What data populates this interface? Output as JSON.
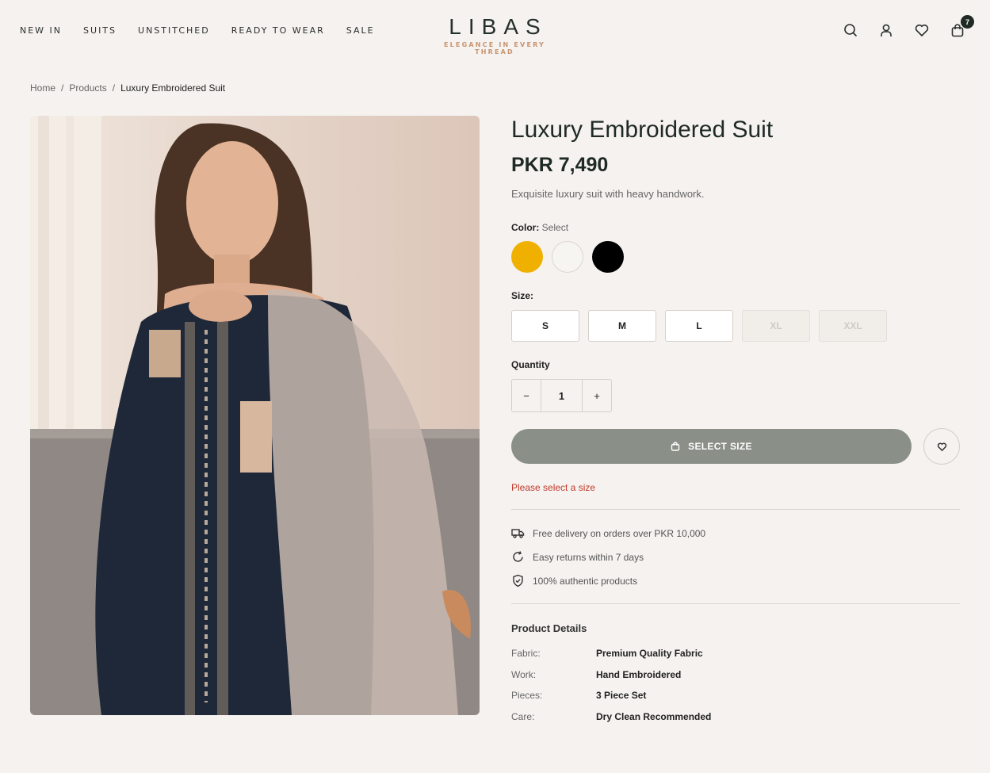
{
  "nav": [
    "NEW IN",
    "SUITS",
    "UNSTITCHED",
    "READY TO WEAR",
    "SALE"
  ],
  "brand": {
    "name": "LIBAS",
    "tagline": "ELEGANCE IN EVERY THREAD"
  },
  "header_icons": [
    "search-icon",
    "user-icon",
    "heart-icon",
    "cart-icon"
  ],
  "cart_count": "7",
  "breadcrumb": {
    "home": "Home",
    "products": "Products",
    "current": "Luxury Embroidered Suit",
    "sep": "/"
  },
  "product": {
    "title": "Luxury Embroidered Suit",
    "price": "PKR 7,490",
    "description": "Exquisite luxury suit with heavy handwork.",
    "color_label": "Color:",
    "color_value": "Select",
    "colors": [
      "#f0b000",
      "#f7f5f2",
      "#000000"
    ],
    "size_label": "Size:",
    "sizes": [
      {
        "label": "S",
        "available": true
      },
      {
        "label": "M",
        "available": true
      },
      {
        "label": "L",
        "available": true
      },
      {
        "label": "XL",
        "available": false
      },
      {
        "label": "XXL",
        "available": false
      }
    ],
    "quantity_label": "Quantity",
    "quantity": "1",
    "minus": "−",
    "plus": "+",
    "cta": "SELECT SIZE",
    "error": "Please select a size"
  },
  "perks": [
    {
      "icon": "truck-icon",
      "text": "Free delivery on orders over PKR 10,000"
    },
    {
      "icon": "refresh-icon",
      "text": "Easy returns within 7 days"
    },
    {
      "icon": "shield-check-icon",
      "text": "100% authentic products"
    }
  ],
  "details": {
    "title": "Product Details",
    "rows": [
      {
        "key": "Fabric:",
        "value": "Premium Quality Fabric"
      },
      {
        "key": "Work:",
        "value": "Hand Embroidered"
      },
      {
        "key": "Pieces:",
        "value": "3 Piece Set"
      },
      {
        "key": "Care:",
        "value": "Dry Clean Recommended"
      }
    ]
  }
}
